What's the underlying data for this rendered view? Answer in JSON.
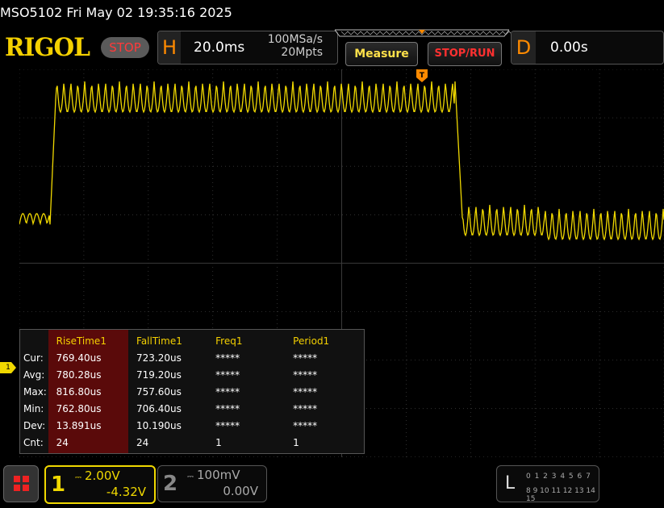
{
  "header": {
    "title": "MSO5102  Fri May 02 19:35:16 2025",
    "logo": "RIGOL",
    "run_state": "STOP",
    "horizontal": {
      "letter": "H",
      "timebase": "20.0ms",
      "sample_rate": "100MSa/s",
      "memory_depth": "20Mpts"
    },
    "measure_label": "Measure",
    "stoprun_label": "STOP/RUN",
    "delay": {
      "letter": "D",
      "value": "0.00s"
    }
  },
  "colors": {
    "channel1": "#f0d800",
    "trigger": "#ff8a00",
    "stop": "#ff3a3a",
    "grid": "#3a3a3a",
    "meas_highlight": "#5a0a0a"
  },
  "screen": {
    "trigger_marker": "T",
    "ch1_marker": "1"
  },
  "trace": {
    "segments_note": "low idle, high burst, low idle",
    "low_level_div": 0.0,
    "high_level_div": 3.0,
    "burst_start_div": 0.7,
    "burst_end_div": 9.0,
    "ripple_amplitude_div": 0.45
  },
  "measurements": {
    "columns": [
      "RiseTime1",
      "FallTime1",
      "Freq1",
      "Period1"
    ],
    "rows": [
      {
        "label": "Cur:",
        "values": [
          "769.40us",
          "723.20us",
          "*****",
          "*****"
        ]
      },
      {
        "label": "Avg:",
        "values": [
          "780.28us",
          "719.20us",
          "*****",
          "*****"
        ]
      },
      {
        "label": "Max:",
        "values": [
          "816.80us",
          "757.60us",
          "*****",
          "*****"
        ]
      },
      {
        "label": "Min:",
        "values": [
          "762.80us",
          "706.40us",
          "*****",
          "*****"
        ]
      },
      {
        "label": "Dev:",
        "values": [
          "13.891us",
          "10.190us",
          "*****",
          "*****"
        ]
      },
      {
        "label": "Cnt:",
        "values": [
          "24",
          "24",
          "1",
          "1"
        ]
      }
    ]
  },
  "channels": {
    "ch1": {
      "number": "1",
      "scale": "2.00V",
      "offset": "-4.32V",
      "coupling_icon": "dc-coupling-icon"
    },
    "ch2": {
      "number": "2",
      "scale": "100mV",
      "offset": "0.00V",
      "coupling_icon": "dc-coupling-icon"
    }
  },
  "logic": {
    "letter": "L",
    "row1": "0 1 2 3  4 5 6 7",
    "row2": "8 9 10 11 12 13 14 15"
  }
}
